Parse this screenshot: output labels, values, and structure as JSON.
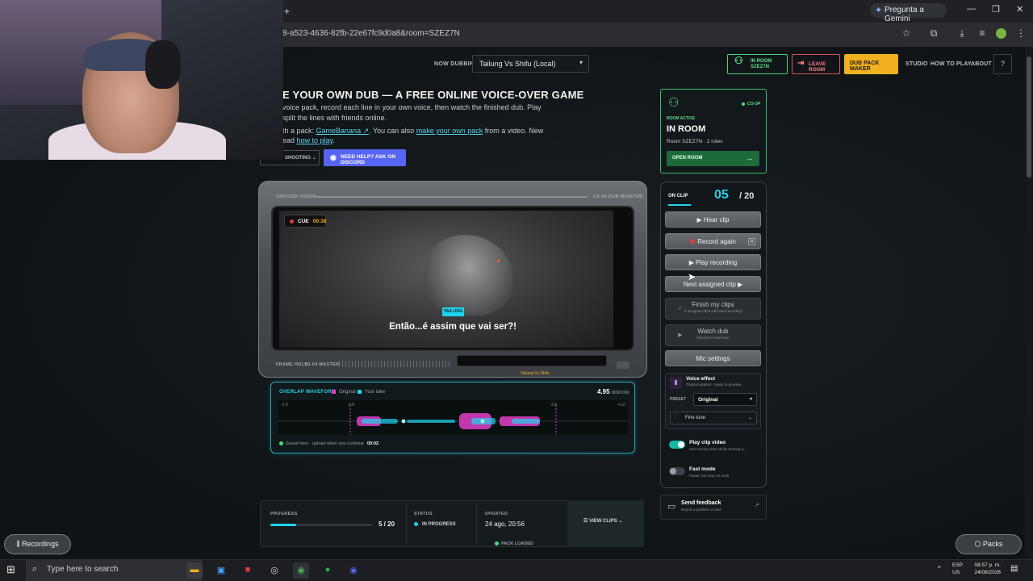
{
  "browser": {
    "url": "8-a523-4636-82fb-22e67fc9d0a8&room=SZEZ7N",
    "gemini_label": "Pregunta a Gemini",
    "new_tab": "+",
    "win_min": "—",
    "win_restore": "❐",
    "win_close": "✕"
  },
  "nav": {
    "now_dubbing_label": "NOW DUBBING",
    "pack_selected": "Tailung Vs Shifu (Local)",
    "in_room_line1": "IN ROOM",
    "in_room_line2": "SZEZ7N",
    "leave_room": "LEAVE ROOM",
    "dub_pack_maker": "DUB PACK MAKER",
    "studio": "STUDIO",
    "how_to_play": "HOW TO PLAY",
    "about": "ABOUT",
    "help": "?"
  },
  "hero": {
    "title": "E YOUR OWN DUB — A FREE ONLINE VOICE-OVER GAME",
    "line1": "voice pack, record each line in your own voice, then watch the finished dub. Play",
    "line2": "split the lines with friends online.",
    "line3_a": "th a pack: ",
    "line3_link1": "GameBanana ↗",
    "line3_b": ". You can also ",
    "line3_link2": "make your own pack",
    "line3_c": " from a video. New",
    "line4_a": "ead ",
    "line4_link": "how to play",
    "line4_b": ".",
    "troubleshooting": "SHOOTING",
    "discord": "NEED HELP? ASK ON DISCORD"
  },
  "monitor": {
    "brand_left": "CHOICER VISION",
    "brand_right": "CX-24 DUB MONITOR",
    "cue_label": "CUE",
    "cue_time": "00:38",
    "speaker": "TAILUNG",
    "subtitle": "Então...é assim que vai ser?!",
    "frame_hold": "FRAME HOLD",
    "master": "53-04 MASTER",
    "tiny_label": "Tailung Vs Shifu"
  },
  "waveform": {
    "title": "OVERLAP WAVEFORM",
    "legend_original": "Original",
    "legend_take": "Your take",
    "window_value": "4.95",
    "window_label": "WINDOW",
    "axis": [
      "-1.0",
      "0.0",
      "2.6",
      "+1.0"
    ],
    "saved_text": "Saved here · upload when you continue",
    "saved_time": "00:02",
    "colors": {
      "original": "#e040c8",
      "take": "#22d3ee"
    }
  },
  "progress": {
    "progress_label": "PROGRESS",
    "progress_value": "5 / 20",
    "progress_fraction": 0.25,
    "status_label": "STATUS",
    "status_value": "IN PROGRESS",
    "updated_label": "UPDATED",
    "updated_value": "24 ago, 20:56",
    "view_clips": "VIEW CLIPS",
    "pack_loaded": "PACK LOADED"
  },
  "room": {
    "coop": "CO-OP",
    "room_active": "ROOM ACTIVE",
    "in_room": "IN ROOM",
    "room_sub": "Room SZEZ7N · 2 roles",
    "open_room": "OPEN ROOM"
  },
  "clips": {
    "on_clip": "ON CLIP",
    "current": "05",
    "total": "/ 20",
    "hear_clip": "▶ Hear clip",
    "record_again": "Record again",
    "record_key": "R",
    "play_recording": "▶ Play recording",
    "next_clip": "Next assigned clip ▶",
    "finish": "Finish my clips",
    "finish_sub": "8 assigned clips still need recording",
    "watch": "Watch dub",
    "watch_sub": "Record 6 more lines",
    "mic_settings": "Mic settings"
  },
  "voice_effect": {
    "title": "Voice effect",
    "sub": "Original applied · ready to preview",
    "preset_label": "PRESET",
    "preset_value": "Original",
    "fine_tune": "Fine tune"
  },
  "toggles": {
    "play_video_title": "Play clip video",
    "play_video_sub": "Use moving video while hearing a...",
    "play_video_on": true,
    "fast_mode_title": "Fast mode",
    "fast_mode_sub": "Faster, but may not work",
    "fast_mode_on": false
  },
  "feedback": {
    "title": "Send feedback",
    "sub": "Report a problem or idea"
  },
  "pills": {
    "recordings": "Recordings",
    "packs": "Packs"
  },
  "taskbar": {
    "search_placeholder": "Type here to search",
    "lang1": "ESP",
    "lang2": "US",
    "time": "08:57 p. m.",
    "date": "24/08/2026"
  }
}
